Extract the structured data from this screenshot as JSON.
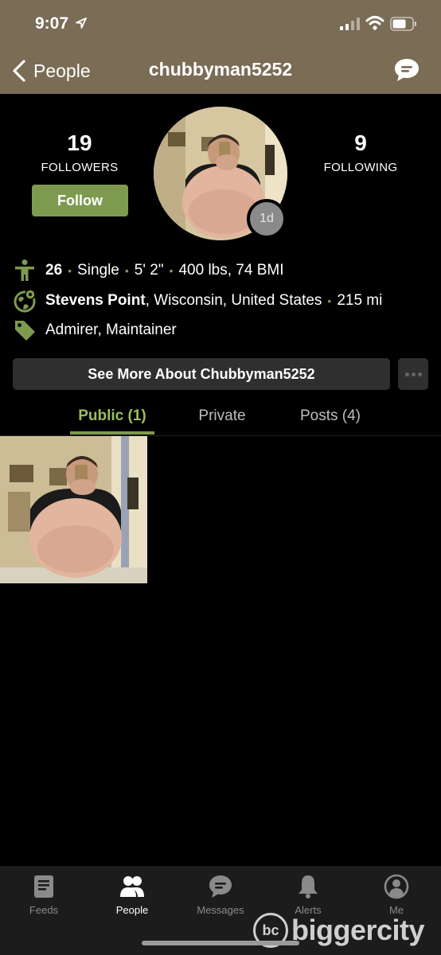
{
  "status_bar": {
    "time": "9:07"
  },
  "header": {
    "back_label": "People",
    "title": "chubbyman5252"
  },
  "profile": {
    "followers_count": "19",
    "followers_label": "FOLLOWERS",
    "following_count": "9",
    "following_label": "FOLLOWING",
    "follow_button": "Follow",
    "avatar_badge": "1d"
  },
  "info": {
    "age": "26",
    "status": "Single",
    "height": "5' 2\"",
    "weight_bmi": "400 lbs, 74 BMI",
    "city": "Stevens Point",
    "region": ", Wisconsin, United States",
    "distance": "215 mi",
    "tags": "Admirer, Maintainer",
    "separator": "•"
  },
  "see_more_button": "See More About Chubbyman5252",
  "tabs": [
    {
      "label": "Public (1)",
      "active": true
    },
    {
      "label": "Private",
      "active": false
    },
    {
      "label": "Posts (4)",
      "active": false
    }
  ],
  "bottom_nav": [
    {
      "label": "Feeds",
      "icon": "feeds-icon"
    },
    {
      "label": "People",
      "icon": "people-icon",
      "active": true
    },
    {
      "label": "Messages",
      "icon": "messages-icon"
    },
    {
      "label": "Alerts",
      "icon": "bell-icon"
    },
    {
      "label": "Me",
      "icon": "user-circle-icon"
    }
  ],
  "watermark": {
    "logo": "bc",
    "text": "biggercity"
  },
  "colors": {
    "header": "#7a6c55",
    "accent": "#7e9a4f",
    "tab_active": "#9bbf5c",
    "nav_bg": "#1c1c1c"
  }
}
